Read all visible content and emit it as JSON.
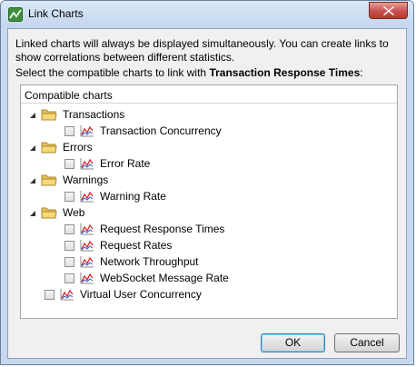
{
  "window": {
    "title": "Link Charts"
  },
  "intro_text": "Linked charts will always be displayed simultaneously. You can create links to show correlations between different statistics.",
  "select_prefix": "Select the compatible charts to link with ",
  "select_target": "Transaction Response Times",
  "select_suffix": ":",
  "tree": {
    "header": "Compatible charts",
    "groups": [
      {
        "label": "Transactions",
        "items": [
          {
            "label": "Transaction Concurrency",
            "checked": false
          }
        ]
      },
      {
        "label": "Errors",
        "items": [
          {
            "label": "Error Rate",
            "checked": false
          }
        ]
      },
      {
        "label": "Warnings",
        "items": [
          {
            "label": "Warning Rate",
            "checked": false
          }
        ]
      },
      {
        "label": "Web",
        "items": [
          {
            "label": "Request Response Times",
            "checked": false
          },
          {
            "label": "Request Rates",
            "checked": false
          },
          {
            "label": "Network Throughput",
            "checked": false
          },
          {
            "label": "WebSocket Message Rate",
            "checked": false
          }
        ]
      }
    ],
    "standalone": {
      "label": "Virtual User Concurrency",
      "checked": false
    }
  },
  "buttons": {
    "ok": "OK",
    "cancel": "Cancel"
  },
  "colors": {
    "chart_line_red": "#d42a2a",
    "chart_line_blue": "#2a5bd4",
    "folder_yellow": "#e8c25a"
  }
}
